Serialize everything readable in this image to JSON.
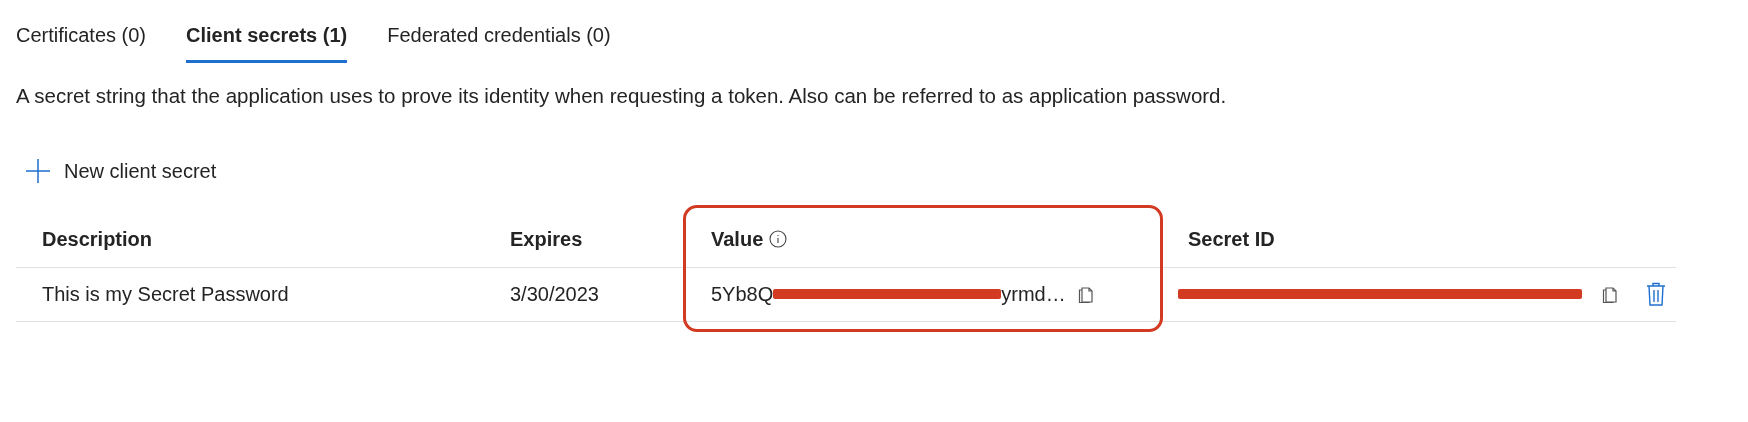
{
  "tabs": [
    {
      "label": "Certificates (0)",
      "selected": false
    },
    {
      "label": "Client secrets (1)",
      "selected": true
    },
    {
      "label": "Federated credentials (0)",
      "selected": false
    }
  ],
  "description": "A secret string that the application uses to prove its identity when requesting a token. Also can be referred to as application password.",
  "new_button": {
    "label": "New client secret"
  },
  "table": {
    "columns": [
      {
        "label": "Description",
        "info": false
      },
      {
        "label": "Expires",
        "info": false
      },
      {
        "label": "Value",
        "info": true,
        "highlighted": true
      },
      {
        "label": "Secret ID",
        "info": false
      }
    ],
    "rows": [
      {
        "description": "This is my Secret Password",
        "expires": "3/30/2023",
        "value": {
          "start": "5Yb8Q",
          "end": "yrmd…",
          "redacted": true
        },
        "secret_id": {
          "redacted": true
        }
      }
    ]
  },
  "annotation": {
    "kind": "highlight",
    "color": "#d23a22"
  }
}
